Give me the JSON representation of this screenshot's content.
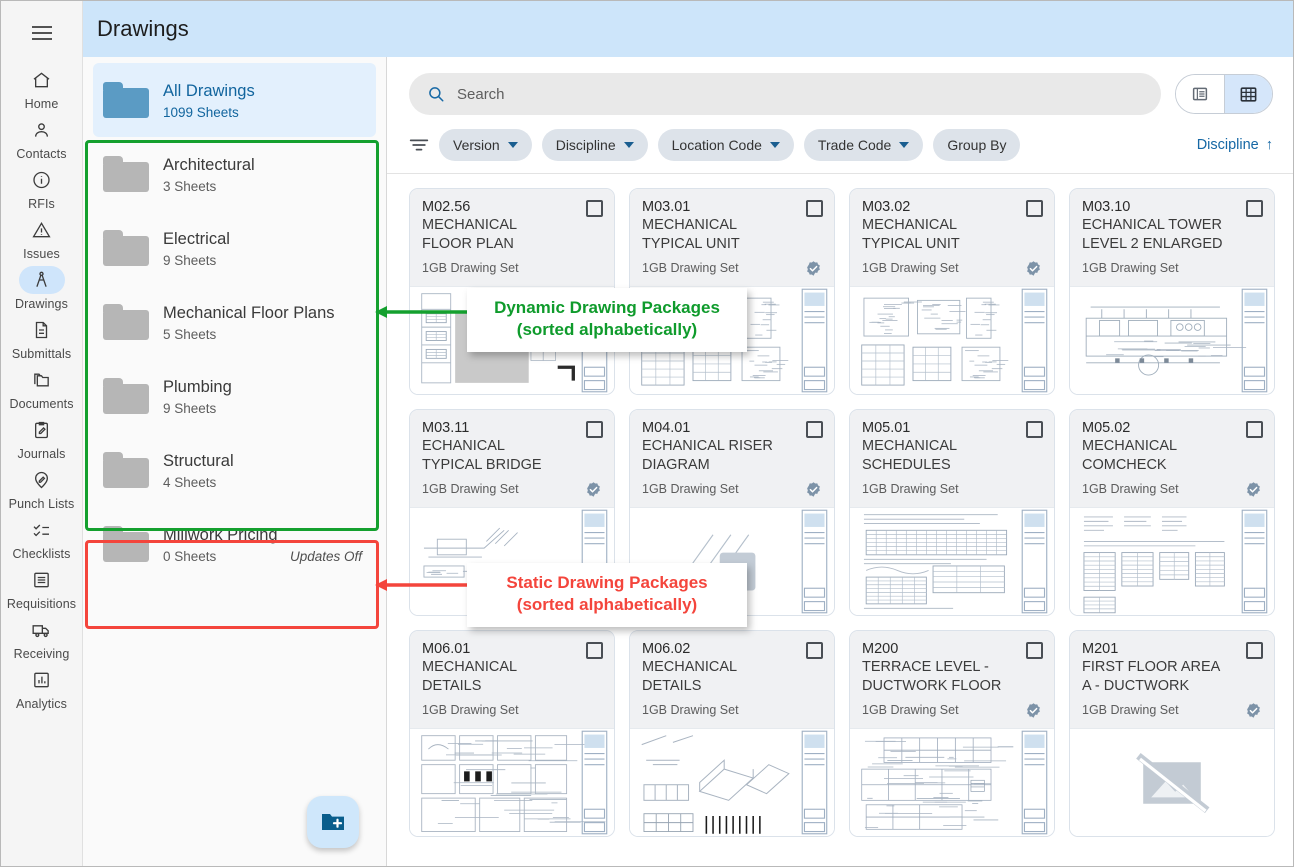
{
  "sidebar": {
    "menu_icon": "hamburger-menu-icon",
    "items": [
      {
        "label": "Home",
        "icon": "home-icon",
        "active": false
      },
      {
        "label": "Contacts",
        "icon": "person-icon",
        "active": false
      },
      {
        "label": "RFIs",
        "icon": "info-circle-icon",
        "active": false
      },
      {
        "label": "Issues",
        "icon": "warning-triangle-icon",
        "active": false
      },
      {
        "label": "Drawings",
        "icon": "compass-icon",
        "active": true
      },
      {
        "label": "Submittals",
        "icon": "document-icon",
        "active": false
      },
      {
        "label": "Documents",
        "icon": "folders-icon",
        "active": false
      },
      {
        "label": "Journals",
        "icon": "clipboard-pencil-icon",
        "active": false
      },
      {
        "label": "Punch Lists",
        "icon": "pin-pencil-icon",
        "active": false
      },
      {
        "label": "Checklists",
        "icon": "checklist-icon",
        "active": false
      },
      {
        "label": "Requisitions",
        "icon": "receipt-icon",
        "active": false
      },
      {
        "label": "Receiving",
        "icon": "truck-icon",
        "active": false
      },
      {
        "label": "Analytics",
        "icon": "bar-chart-icon",
        "active": false
      }
    ]
  },
  "header": {
    "title": "Drawings"
  },
  "folder_panel": {
    "all": {
      "name": "All Drawings",
      "sheets": "1099 Sheets"
    },
    "dynamic": [
      {
        "name": "Architectural",
        "sheets": "3 Sheets",
        "updates": ""
      },
      {
        "name": "Electrical",
        "sheets": "9 Sheets",
        "updates": ""
      },
      {
        "name": "Mechanical Floor Plans",
        "sheets": "5 Sheets",
        "updates": ""
      },
      {
        "name": "Plumbing",
        "sheets": "9 Sheets",
        "updates": ""
      },
      {
        "name": "Structural",
        "sheets": "4 Sheets",
        "updates": ""
      }
    ],
    "static": [
      {
        "name": "Millwork Pricing",
        "sheets": "0 Sheets",
        "updates": "Updates Off"
      }
    ],
    "add_button": "add-folder-fab"
  },
  "toolbar": {
    "search_placeholder": "Search",
    "search_value": "",
    "view_list": "list-view-icon",
    "view_grid": "grid-view-icon",
    "filter_icon": "filter-icon",
    "chips": [
      "Version",
      "Discipline",
      "Location Code",
      "Trade Code"
    ],
    "group_by": "Group By",
    "sort_label": "Discipline",
    "sort_direction": "↑"
  },
  "cards": [
    {
      "num": "M02.56",
      "title": "MECHANICAL FLOOR PLAN MIDRISE - RO…",
      "set": "1GB Drawing Set",
      "verified": false,
      "thumb": "floorplan-shaded"
    },
    {
      "num": "M03.01",
      "title": "MECHANICAL TYPICAL UNIT FLOO…",
      "set": "1GB Drawing Set",
      "verified": true,
      "thumb": "detail-sheets"
    },
    {
      "num": "M03.02",
      "title": "MECHANICAL TYPICAL UNIT FLOO…",
      "set": "1GB Drawing Set",
      "verified": true,
      "thumb": "detail-sheets"
    },
    {
      "num": "M03.10",
      "title": "ECHANICAL TOWER LEVEL 2 ENLARGED …",
      "set": "1GB Drawing Set",
      "verified": false,
      "thumb": "enlarged-plan"
    },
    {
      "num": "M03.11",
      "title": "ECHANICAL TYPICAL BRIDGE ENLARGED …",
      "set": "1GB Drawing Set",
      "verified": true,
      "thumb": "bridge-plan"
    },
    {
      "num": "M04.01",
      "title": "ECHANICAL RISER DIAGRAM",
      "set": "1GB Drawing Set",
      "verified": true,
      "thumb": "riser-diagram"
    },
    {
      "num": "M05.01",
      "title": "MECHANICAL SCHEDULES",
      "set": "1GB Drawing Set",
      "verified": false,
      "thumb": "schedule-table"
    },
    {
      "num": "M05.02",
      "title": "MECHANICAL COMCHECK",
      "set": "1GB Drawing Set",
      "verified": true,
      "thumb": "comcheck-table"
    },
    {
      "num": "M06.01",
      "title": "MECHANICAL DETAILS",
      "set": "1GB Drawing Set",
      "verified": false,
      "thumb": "details-grid"
    },
    {
      "num": "M06.02",
      "title": "MECHANICAL DETAILS",
      "set": "1GB Drawing Set",
      "verified": false,
      "thumb": "iso-details"
    },
    {
      "num": "M200",
      "title": "TERRACE LEVEL - DUCTWORK FLOOR  …",
      "set": "1GB Drawing Set",
      "verified": true,
      "thumb": "ductwork-plan"
    },
    {
      "num": "M201",
      "title": "FIRST FLOOR AREA A - DUCTWORK PLAN",
      "set": "1GB Drawing Set",
      "verified": true,
      "thumb": "broken-image"
    }
  ],
  "annotations": {
    "green": {
      "line1": "Dynamic Drawing Packages",
      "line2": "(sorted alphabetically)",
      "color": "#0f9b2c"
    },
    "red": {
      "line1": "Static Drawing Packages",
      "line2": "(sorted alphabetically)",
      "color": "#f4453c"
    }
  }
}
